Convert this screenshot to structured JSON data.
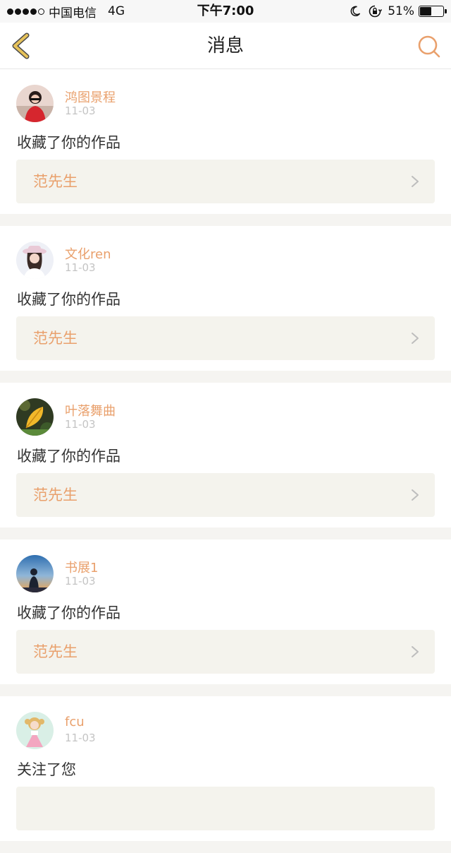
{
  "status_bar": {
    "carrier": "中国电信",
    "network": "4G",
    "time": "下午7:00",
    "battery_percent": "51%",
    "battery_level": 0.51,
    "icons": [
      "signal-icon",
      "moon-icon",
      "orientation-lock-icon",
      "battery-icon"
    ]
  },
  "nav": {
    "title": "消息",
    "back_icon": "chevron-left-icon",
    "search_icon": "search-icon",
    "accent_color": "#e9a06c",
    "back_color": "#e6c25a"
  },
  "messages": [
    {
      "user": "鸿图景程",
      "date": "11-03",
      "action": "收藏了你的作品",
      "target": "范先生",
      "avatar": "avatar-red-dress"
    },
    {
      "user": "文化ren",
      "date": "11-03",
      "action": "收藏了你的作品",
      "target": "范先生",
      "avatar": "avatar-hat-girl"
    },
    {
      "user": "叶落舞曲",
      "date": "11-03",
      "action": "收藏了你的作品",
      "target": "范先生",
      "avatar": "avatar-yellow-leaf"
    },
    {
      "user": "书展1",
      "date": "11-03",
      "action": "收藏了你的作品",
      "target": "范先生",
      "avatar": "avatar-sunset-silhouette"
    },
    {
      "user": "fcu",
      "date": "11-03",
      "action": "关注了您",
      "target": "",
      "avatar": "avatar-cartoon-girl"
    }
  ]
}
